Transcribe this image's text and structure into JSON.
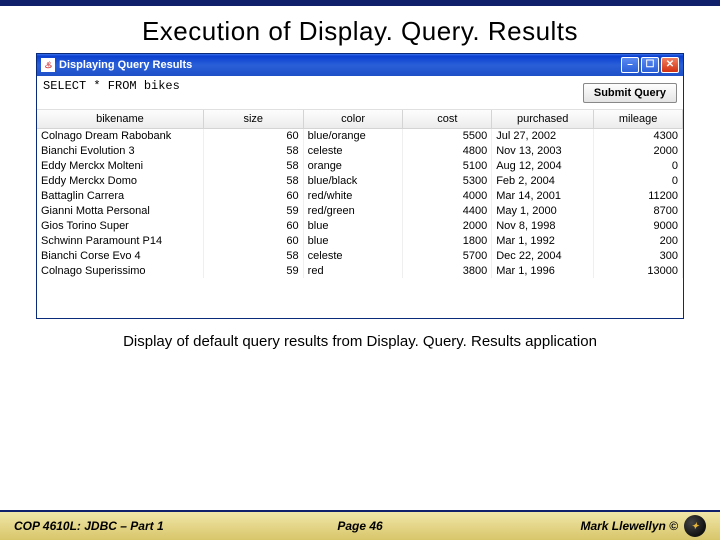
{
  "slide": {
    "title": "Execution of Display. Query. Results",
    "caption": "Display of default query results from Display. Query. Results application"
  },
  "window": {
    "icon_glyph": "♨",
    "title": "Displaying Query Results",
    "query_text": "SELECT * FROM bikes",
    "submit_label": "Submit Query"
  },
  "table": {
    "columns": [
      "bikename",
      "size",
      "color",
      "cost",
      "purchased",
      "mileage"
    ],
    "rows": [
      {
        "bikename": "Colnago Dream Rabobank",
        "size": "60",
        "color": "blue/orange",
        "cost": "5500",
        "purchased": "Jul 27, 2002",
        "mileage": "4300"
      },
      {
        "bikename": "Bianchi Evolution 3",
        "size": "58",
        "color": "celeste",
        "cost": "4800",
        "purchased": "Nov 13, 2003",
        "mileage": "2000"
      },
      {
        "bikename": "Eddy Merckx Molteni",
        "size": "58",
        "color": "orange",
        "cost": "5100",
        "purchased": "Aug 12, 2004",
        "mileage": "0"
      },
      {
        "bikename": "Eddy Merckx Domo",
        "size": "58",
        "color": "blue/black",
        "cost": "5300",
        "purchased": "Feb 2, 2004",
        "mileage": "0"
      },
      {
        "bikename": "Battaglin Carrera",
        "size": "60",
        "color": "red/white",
        "cost": "4000",
        "purchased": "Mar 14, 2001",
        "mileage": "11200"
      },
      {
        "bikename": "Gianni Motta Personal",
        "size": "59",
        "color": "red/green",
        "cost": "4400",
        "purchased": "May 1, 2000",
        "mileage": "8700"
      },
      {
        "bikename": "Gios Torino Super",
        "size": "60",
        "color": "blue",
        "cost": "2000",
        "purchased": "Nov 8, 1998",
        "mileage": "9000"
      },
      {
        "bikename": "Schwinn Paramount P14",
        "size": "60",
        "color": "blue",
        "cost": "1800",
        "purchased": "Mar 1, 1992",
        "mileage": "200"
      },
      {
        "bikename": "Bianchi Corse Evo 4",
        "size": "58",
        "color": "celeste",
        "cost": "5700",
        "purchased": "Dec 22, 2004",
        "mileage": "300"
      },
      {
        "bikename": "Colnago Superissimo",
        "size": "59",
        "color": "red",
        "cost": "3800",
        "purchased": "Mar 1, 1996",
        "mileage": "13000"
      }
    ]
  },
  "footer": {
    "left": "COP 4610L: JDBC – Part 1",
    "center": "Page 46",
    "right": "Mark Llewellyn ©"
  }
}
